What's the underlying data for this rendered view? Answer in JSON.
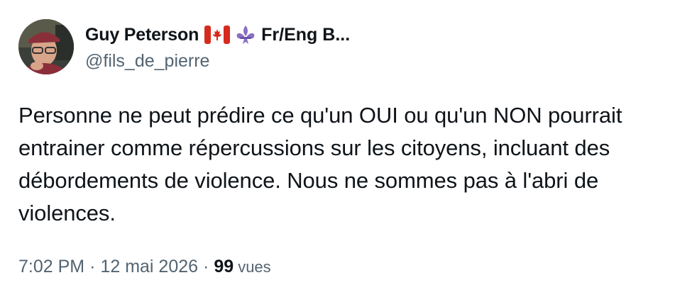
{
  "author": {
    "display_name": "Guy Peterson",
    "name_suffix": "Fr/Eng B...",
    "handle": "@fils_de_pierre",
    "badges": [
      "canada-flag-icon",
      "fleur-de-lis-icon"
    ]
  },
  "tweet": {
    "text": "Personne ne peut prédire ce qu'un OUI ou qu'un NON pourrait entrainer comme répercussions sur les citoyens, incluant des débordements de violence. Nous ne sommes pas à l'abri de violences."
  },
  "meta": {
    "time": "7:02 PM",
    "separator": "·",
    "date": "12 mai 2026",
    "views_count": "99",
    "views_label": "vues"
  },
  "colors": {
    "text_primary": "#0f1419",
    "text_secondary": "#536471",
    "flag_red": "#d52b1e",
    "fleur_purple": "#8a6fc2"
  }
}
